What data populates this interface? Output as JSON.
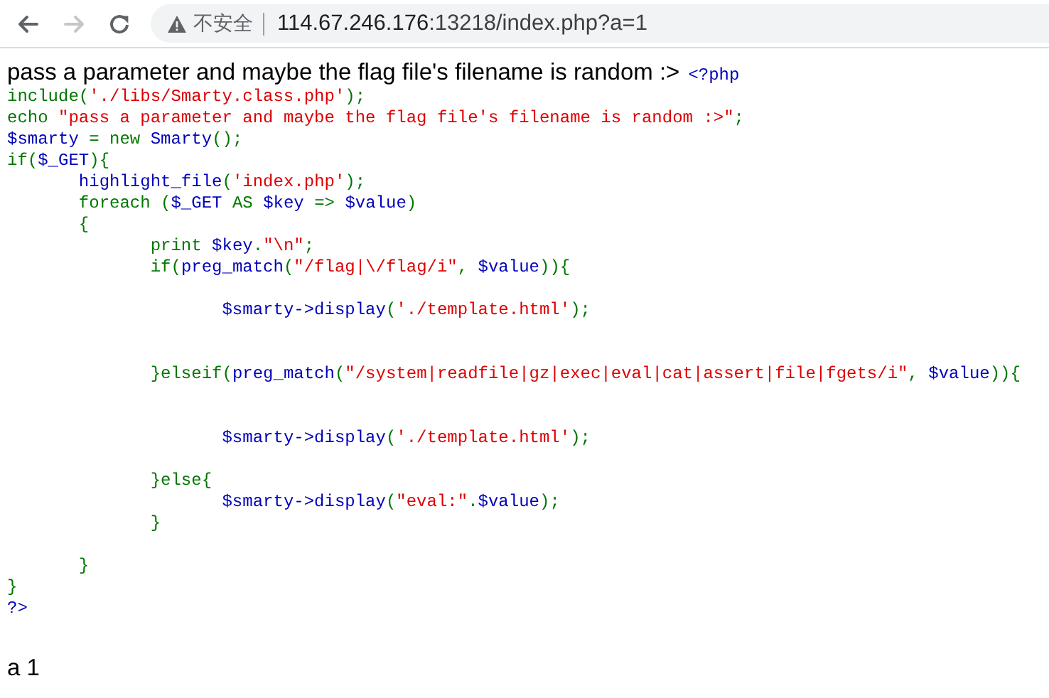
{
  "browser": {
    "back_enabled": true,
    "forward_enabled": false,
    "security_label": "不安全",
    "url_host": "114.67.246.176",
    "url_rest": ":13218/index.php?a=1"
  },
  "page": {
    "intro": "pass a parameter and maybe the flag file's filename is random :>",
    "code": [
      {
        "kind": "code",
        "tokens": [
          {
            "kind": "default",
            "text": "<?php"
          }
        ]
      },
      {
        "kind": "code",
        "tokens": [
          {
            "kind": "keyword",
            "text": "include("
          },
          {
            "kind": "string",
            "text": "'./libs/Smarty.class.php'"
          },
          {
            "kind": "keyword",
            "text": ");"
          }
        ]
      },
      {
        "kind": "code",
        "tokens": [
          {
            "kind": "keyword",
            "text": "echo "
          },
          {
            "kind": "string",
            "text": "\"pass a parameter and maybe the flag file's filename is random :>\""
          },
          {
            "kind": "keyword",
            "text": ";"
          }
        ]
      },
      {
        "kind": "code",
        "tokens": [
          {
            "kind": "default",
            "text": "$smarty"
          },
          {
            "kind": "keyword",
            "text": " = new "
          },
          {
            "kind": "default",
            "text": "Smarty"
          },
          {
            "kind": "keyword",
            "text": "();"
          }
        ]
      },
      {
        "kind": "code",
        "tokens": [
          {
            "kind": "keyword",
            "text": "if("
          },
          {
            "kind": "default",
            "text": "$_GET"
          },
          {
            "kind": "keyword",
            "text": "){"
          }
        ]
      },
      {
        "kind": "code",
        "tokens": [
          {
            "kind": "default",
            "text": "\thighlight_file"
          },
          {
            "kind": "keyword",
            "text": "("
          },
          {
            "kind": "string",
            "text": "'index.php'"
          },
          {
            "kind": "keyword",
            "text": ");"
          }
        ]
      },
      {
        "kind": "code",
        "tokens": [
          {
            "kind": "keyword",
            "text": "\tforeach ("
          },
          {
            "kind": "default",
            "text": "$_GET "
          },
          {
            "kind": "keyword",
            "text": "AS "
          },
          {
            "kind": "default",
            "text": "$key "
          },
          {
            "kind": "keyword",
            "text": "=> "
          },
          {
            "kind": "default",
            "text": "$value"
          },
          {
            "kind": "keyword",
            "text": ")"
          }
        ]
      },
      {
        "kind": "code",
        "tokens": [
          {
            "kind": "keyword",
            "text": "\t{"
          }
        ]
      },
      {
        "kind": "code",
        "tokens": [
          {
            "kind": "keyword",
            "text": "\t\tprint "
          },
          {
            "kind": "default",
            "text": "$key"
          },
          {
            "kind": "keyword",
            "text": "."
          },
          {
            "kind": "string",
            "text": "\"\\n\""
          },
          {
            "kind": "keyword",
            "text": ";"
          }
        ]
      },
      {
        "kind": "code",
        "tokens": [
          {
            "kind": "keyword",
            "text": "\t\tif("
          },
          {
            "kind": "default",
            "text": "preg_match"
          },
          {
            "kind": "keyword",
            "text": "("
          },
          {
            "kind": "string",
            "text": "\"/flag|\\/flag/i\""
          },
          {
            "kind": "keyword",
            "text": ", "
          },
          {
            "kind": "default",
            "text": "$value"
          },
          {
            "kind": "keyword",
            "text": ")){"
          }
        ]
      },
      {
        "kind": "blank"
      },
      {
        "kind": "code",
        "tokens": [
          {
            "kind": "default",
            "text": "\t\t\t$smarty->display"
          },
          {
            "kind": "keyword",
            "text": "("
          },
          {
            "kind": "string",
            "text": "'./template.html'"
          },
          {
            "kind": "keyword",
            "text": ");"
          }
        ]
      },
      {
        "kind": "blank"
      },
      {
        "kind": "blank"
      },
      {
        "kind": "code",
        "tokens": [
          {
            "kind": "keyword",
            "text": "\t\t}elseif("
          },
          {
            "kind": "default",
            "text": "preg_match"
          },
          {
            "kind": "keyword",
            "text": "("
          },
          {
            "kind": "string",
            "text": "\"/system|readfile|gz|exec|eval|cat|assert|file|fgets/i\""
          },
          {
            "kind": "keyword",
            "text": ", "
          },
          {
            "kind": "default",
            "text": "$value"
          },
          {
            "kind": "keyword",
            "text": ")){"
          }
        ]
      },
      {
        "kind": "blank"
      },
      {
        "kind": "blank"
      },
      {
        "kind": "code",
        "tokens": [
          {
            "kind": "default",
            "text": "\t\t\t$smarty->display"
          },
          {
            "kind": "keyword",
            "text": "("
          },
          {
            "kind": "string",
            "text": "'./template.html'"
          },
          {
            "kind": "keyword",
            "text": ");"
          }
        ]
      },
      {
        "kind": "blank"
      },
      {
        "kind": "code",
        "tokens": [
          {
            "kind": "keyword",
            "text": "\t\t}else{"
          }
        ]
      },
      {
        "kind": "code",
        "tokens": [
          {
            "kind": "default",
            "text": "\t\t\t$smarty->display"
          },
          {
            "kind": "keyword",
            "text": "("
          },
          {
            "kind": "string",
            "text": "\"eval:\""
          },
          {
            "kind": "keyword",
            "text": "."
          },
          {
            "kind": "default",
            "text": "$value"
          },
          {
            "kind": "keyword",
            "text": ");"
          }
        ]
      },
      {
        "kind": "code",
        "tokens": [
          {
            "kind": "keyword",
            "text": "\t\t}"
          }
        ]
      },
      {
        "kind": "blank"
      },
      {
        "kind": "code",
        "tokens": [
          {
            "kind": "keyword",
            "text": "\t}"
          }
        ]
      },
      {
        "kind": "code",
        "tokens": [
          {
            "kind": "keyword",
            "text": "}"
          }
        ]
      },
      {
        "kind": "code",
        "tokens": [
          {
            "kind": "default",
            "text": "?>"
          }
        ]
      }
    ],
    "output": "a 1"
  }
}
